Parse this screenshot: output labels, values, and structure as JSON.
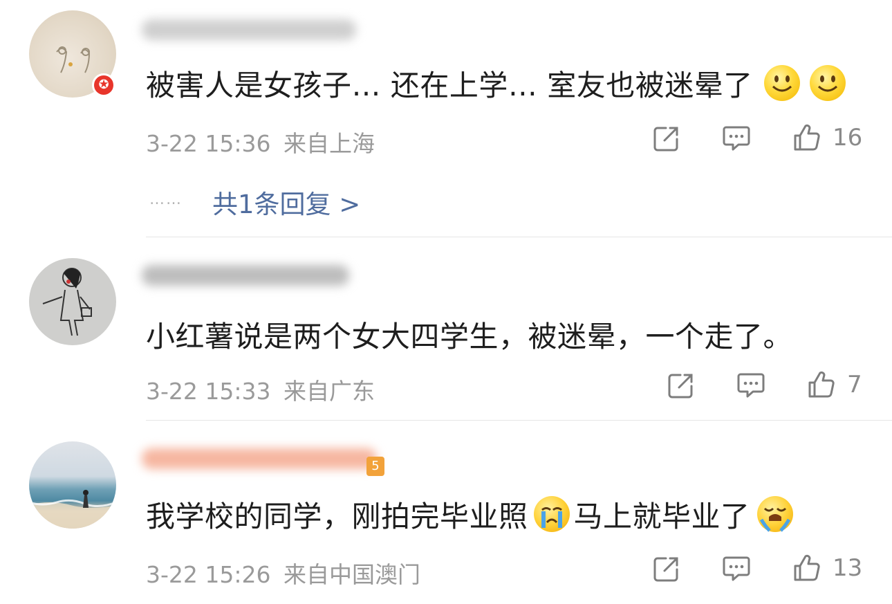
{
  "comments": [
    {
      "text": "被害人是女孩子… 还在上学… 室友也被迷晕了",
      "emojis": [
        "smile-emoji",
        "smile-emoji"
      ],
      "time": "3-22 15:36",
      "location": "来自上海",
      "likes": "16",
      "replies": "共1条回复 >",
      "replies_dots": "……"
    },
    {
      "text": "小红薯说是两个女大四学生，被迷晕，一个走了。",
      "time": "3-22 15:33",
      "location": "来自广东",
      "likes": "7"
    },
    {
      "text_before": "我学校的同学，刚拍完毕业照",
      "text_after": "马上就毕业了",
      "emojis": [
        "crying-emoji",
        "loudly-crying-emoji"
      ],
      "time": "3-22 15:26",
      "location": "来自中国澳门",
      "likes": "13"
    }
  ],
  "colors": {
    "text": "#1e1e1e",
    "meta": "#9a9a9a",
    "link": "#4f6c9e",
    "badge": "#e8352b",
    "divider": "#e6e6e6"
  }
}
